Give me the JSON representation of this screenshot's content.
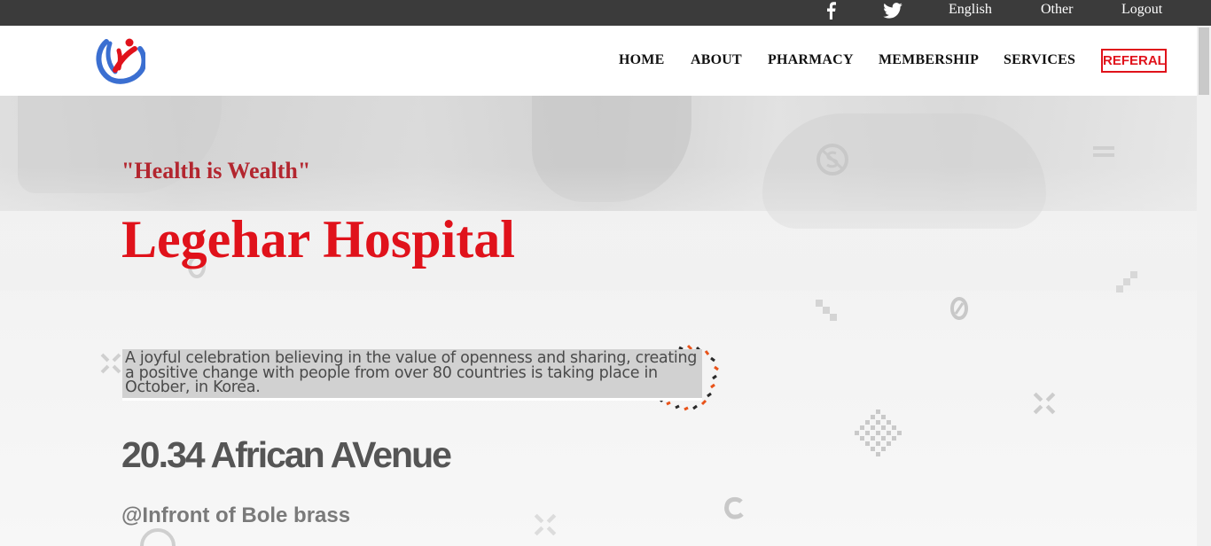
{
  "topbar": {
    "facebook_icon": "facebook-icon",
    "twitter_icon": "twitter-icon",
    "language": "English",
    "other": "Other",
    "logout": "Logout"
  },
  "header": {
    "logo": "hospital-logo",
    "nav": [
      "HOME",
      "ABOUT",
      "PHARMACY",
      "MEMBERSHIP",
      "SERVICES"
    ],
    "referal": "REFERAL"
  },
  "hero": {
    "tagline": "\"Health is Wealth\"",
    "title": "Legehar Hospital",
    "description": "A joyful celebration believing in the value of openness and sharing, creating a positive change with people from over 80 countries is taking place in October, in Korea.",
    "address": "20.34 African AVenue",
    "address_note": "@Infront of Bole brass"
  },
  "colors": {
    "accent_red": "#e0121b",
    "tagline_red": "#b3262f",
    "topbar_bg": "#3b3b3b"
  }
}
